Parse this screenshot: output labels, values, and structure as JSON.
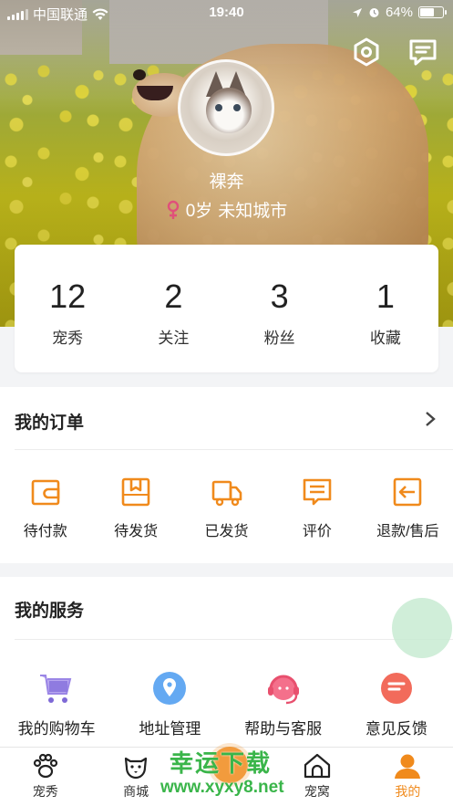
{
  "status_bar": {
    "carrier": "中国联通",
    "time": "19:40",
    "battery": "64%"
  },
  "profile": {
    "name": "裸奔",
    "gender_icon": "female-icon",
    "age": "0岁",
    "city": "未知城市"
  },
  "stats": [
    {
      "value": "12",
      "label": "宠秀"
    },
    {
      "value": "2",
      "label": "关注"
    },
    {
      "value": "3",
      "label": "粉丝"
    },
    {
      "value": "1",
      "label": "收藏"
    }
  ],
  "orders": {
    "title": "我的订单",
    "items": [
      {
        "label": "待付款",
        "icon": "wallet-icon"
      },
      {
        "label": "待发货",
        "icon": "package-icon"
      },
      {
        "label": "已发货",
        "icon": "truck-icon"
      },
      {
        "label": "评价",
        "icon": "comment-icon"
      },
      {
        "label": "退款/售后",
        "icon": "return-icon"
      }
    ]
  },
  "services": {
    "title": "我的服务",
    "items": [
      {
        "label": "我的购物车",
        "icon": "cart-icon"
      },
      {
        "label": "地址管理",
        "icon": "location-icon"
      },
      {
        "label": "帮助与客服",
        "icon": "headset-icon"
      },
      {
        "label": "意见反馈",
        "icon": "feedback-icon"
      }
    ]
  },
  "tabbar": {
    "items": [
      {
        "label": "宠秀",
        "icon": "paw-icon"
      },
      {
        "label": "商城",
        "icon": "dog-face-icon"
      },
      {
        "label": "",
        "icon": "center-icon"
      },
      {
        "label": "宠窝",
        "icon": "house-icon"
      },
      {
        "label": "我的",
        "icon": "person-icon"
      }
    ],
    "active_index": 4
  },
  "watermark": {
    "line1": "幸运下载",
    "line2": "www.xyxy8.net"
  },
  "colors": {
    "accent": "#f08a1c",
    "female": "#e0507a"
  }
}
